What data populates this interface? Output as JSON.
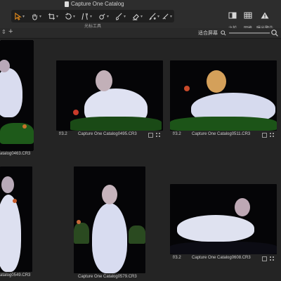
{
  "window": {
    "title": "Capture One Catalog"
  },
  "toolbar": {
    "tool_group_label": "光标工具",
    "tools": [
      {
        "icon": "select-cursor-icon",
        "active": true
      },
      {
        "icon": "pan-hand-icon"
      },
      {
        "icon": "crop-icon"
      },
      {
        "icon": "rotate-icon"
      },
      {
        "icon": "keystone-icon"
      },
      {
        "icon": "spot-removal-icon"
      },
      {
        "icon": "brush-icon"
      },
      {
        "icon": "eraser-icon"
      },
      {
        "icon": "gradient-mask-icon"
      },
      {
        "icon": "color-picker-icon"
      }
    ],
    "right": [
      {
        "icon": "before-after-icon",
        "label": "之前"
      },
      {
        "icon": "grid-icon",
        "label": "网格"
      },
      {
        "icon": "exposure-warning-icon",
        "label": "曝光警告"
      }
    ]
  },
  "browser_bar": {
    "fit_label": "适合屏幕"
  },
  "thumbnails": [
    {
      "name": "atalog0463.CR3",
      "aperture": "",
      "selected": true
    },
    {
      "name": "Capture One Catalog0495.CR3",
      "aperture": "f/3.2",
      "selected": false
    },
    {
      "name": "Capture One Catalog0511.CR3",
      "aperture": "f/3.2",
      "selected": false
    },
    {
      "name": "atalog0549.CR3",
      "aperture": "",
      "selected": false
    },
    {
      "name": "Capture One Catalog0579.CR3",
      "aperture": "",
      "selected": false
    },
    {
      "name": "Capture One Catalog0608.CR3",
      "aperture": "f/3.2",
      "selected": false
    }
  ],
  "colors": {
    "accent": "#e38a1b",
    "background": "#242424",
    "toolbar": "#2d2d2d"
  }
}
